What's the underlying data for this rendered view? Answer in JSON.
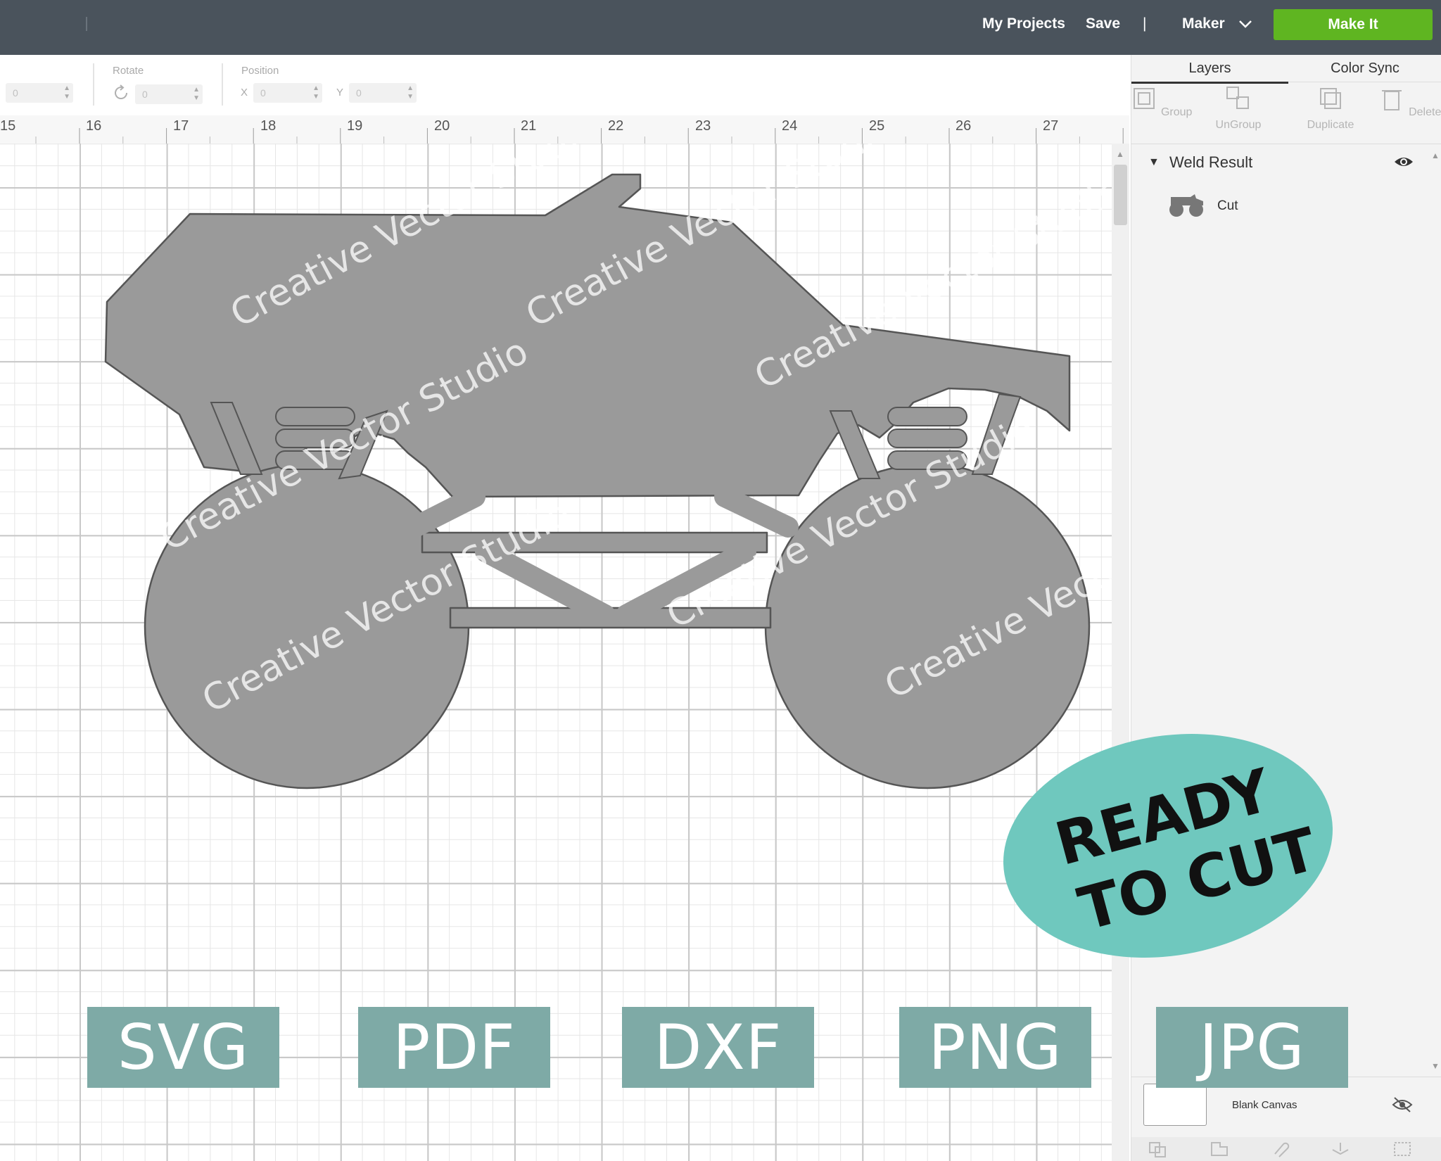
{
  "topbar": {
    "my_projects": "My Projects",
    "save": "Save",
    "separator": "|",
    "machine": "Maker",
    "make_it": "Make It",
    "bar_color": "#4a535c",
    "make_it_color": "#5fb521"
  },
  "edit_toolbar": {
    "rotate_label": "Rotate",
    "position_label": "Position",
    "size_value": "0",
    "rotate_value": "0",
    "x_label": "X",
    "x_value": "0",
    "y_label": "Y",
    "y_value": "0"
  },
  "ruler": {
    "ticks": [
      "15",
      "16",
      "17",
      "18",
      "19",
      "20",
      "21",
      "22",
      "23",
      "24",
      "25",
      "26",
      "27"
    ]
  },
  "panel": {
    "tabs": [
      "Layers",
      "Color Sync"
    ],
    "tools": [
      "Group",
      "UnGroup",
      "Duplicate",
      "Delete"
    ],
    "layer_name": "Weld Result",
    "layer_item": "Cut",
    "blank_canvas": "Blank Canvas"
  },
  "artwork": {
    "fill": "#9a9a9a",
    "watermark": "Creative Vector Studio"
  },
  "badge": {
    "line1": "READY",
    "line2": "TO CUT",
    "color": "#6fc8be"
  },
  "formats": [
    "SVG",
    "PDF",
    "DXF",
    "PNG",
    "JPG"
  ],
  "format_color": "#7eaaa6"
}
